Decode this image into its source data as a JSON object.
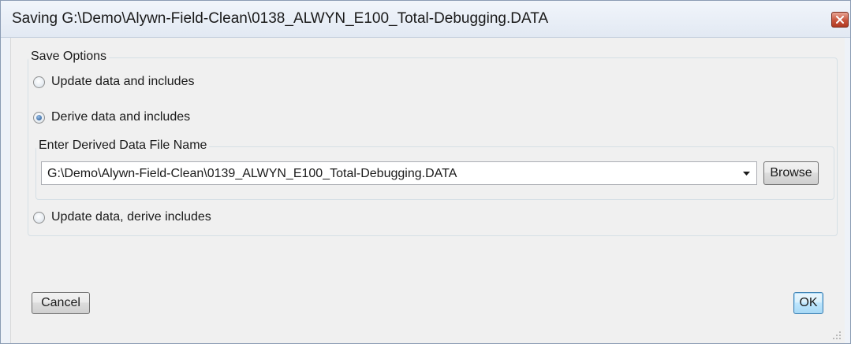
{
  "window": {
    "title": "Saving G:\\Demo\\Alywn-Field-Clean\\0138_ALWYN_E100_Total-Debugging.DATA"
  },
  "save_options": {
    "group_label": "Save Options",
    "options": [
      {
        "label": "Update data and includes",
        "selected": false
      },
      {
        "label": "Derive data and includes",
        "selected": true
      },
      {
        "label": "Update data, derive includes",
        "selected": false
      }
    ]
  },
  "derived_file": {
    "group_label": "Enter Derived Data File Name",
    "value": "G:\\Demo\\Alywn-Field-Clean\\0139_ALWYN_E100_Total-Debugging.DATA",
    "browse_label": "Browse"
  },
  "buttons": {
    "cancel": "Cancel",
    "ok": "OK"
  },
  "icons": {
    "close": "close-icon",
    "dropdown": "chevron-down-icon",
    "resize": "resize-grip-icon"
  },
  "colors": {
    "close_button": "#c7543c",
    "radio_selected": "#1b4f8c",
    "default_button_border": "#3c7fb1"
  }
}
